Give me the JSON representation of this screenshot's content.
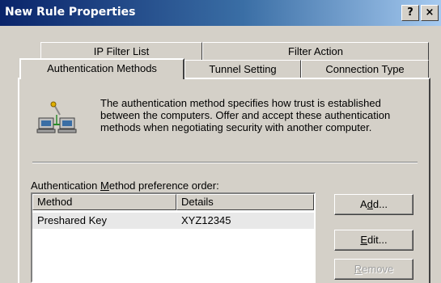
{
  "window": {
    "title": "New Rule Properties",
    "help_label": "?",
    "close_label": "×"
  },
  "tabs": {
    "back_row": [
      {
        "label": "IP Filter List"
      },
      {
        "label": "Filter Action"
      }
    ],
    "front_row": [
      {
        "label": "Authentication Methods",
        "active": true
      },
      {
        "label": "Tunnel Setting"
      },
      {
        "label": "Connection Type"
      }
    ]
  },
  "description": "The authentication method specifies how trust is established between the computers. Offer and accept these authentication methods when negotiating security with another computer.",
  "list": {
    "label_before": "Authentication ",
    "label_mnemonic": "M",
    "label_after": "ethod preference order:",
    "columns": [
      "Method",
      "Details"
    ],
    "rows": [
      {
        "method": "Preshared Key",
        "details": "XYZ12345"
      }
    ]
  },
  "buttons": {
    "add": {
      "before": "A",
      "mnemonic": "d",
      "after": "d..."
    },
    "edit": {
      "before": "",
      "mnemonic": "E",
      "after": "dit..."
    },
    "remove": {
      "before": "",
      "mnemonic": "R",
      "after": "emove",
      "disabled": true
    }
  },
  "icon": "network-computers-icon"
}
